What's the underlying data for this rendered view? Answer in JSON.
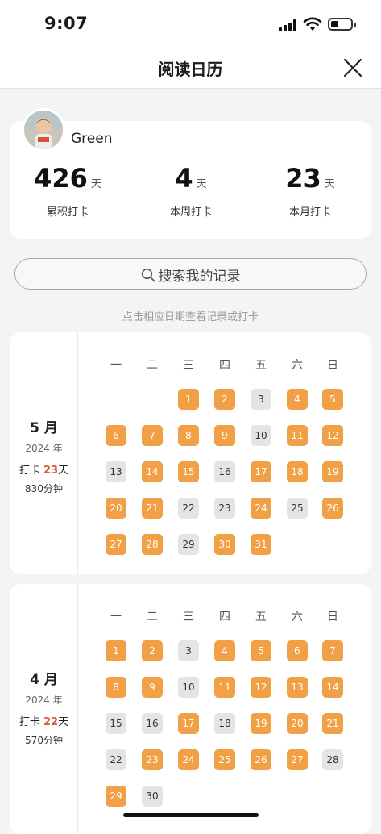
{
  "status": {
    "time": "9:07"
  },
  "nav": {
    "title": "阅读日历"
  },
  "profile": {
    "name": "Green",
    "stats": [
      {
        "value": "426",
        "unit": "天",
        "label": "累积打卡"
      },
      {
        "value": "4",
        "unit": "天",
        "label": "本周打卡"
      },
      {
        "value": "23",
        "unit": "天",
        "label": "本月打卡"
      }
    ]
  },
  "search": {
    "placeholder": "搜索我的记录"
  },
  "hint": "点击相应日期查看记录或打卡",
  "weekdays": [
    "一",
    "二",
    "三",
    "四",
    "五",
    "六",
    "日"
  ],
  "months": [
    {
      "month_label": "5 月",
      "year_label": "2024 年",
      "checkin_prefix": "打卡 ",
      "checkin_days": "23",
      "checkin_suffix": "天",
      "minutes_label": "830分钟",
      "first_weekday": 3,
      "days_in_month": 31,
      "checked_days": [
        1,
        2,
        4,
        5,
        6,
        7,
        8,
        9,
        11,
        12,
        14,
        15,
        17,
        18,
        19,
        20,
        21,
        24,
        26,
        27,
        28,
        30,
        31
      ]
    },
    {
      "month_label": "4 月",
      "year_label": "2024 年",
      "checkin_prefix": "打卡 ",
      "checkin_days": "22",
      "checkin_suffix": "天",
      "minutes_label": "570分钟",
      "first_weekday": 1,
      "days_in_month": 30,
      "checked_days": [
        1,
        2,
        4,
        5,
        6,
        7,
        8,
        9,
        11,
        12,
        13,
        14,
        17,
        19,
        20,
        21,
        23,
        24,
        25,
        26,
        27,
        29
      ]
    }
  ],
  "colors": {
    "checked": "#f2a045",
    "unchecked": "#e4e4e4",
    "highlight": "#e4543f"
  }
}
